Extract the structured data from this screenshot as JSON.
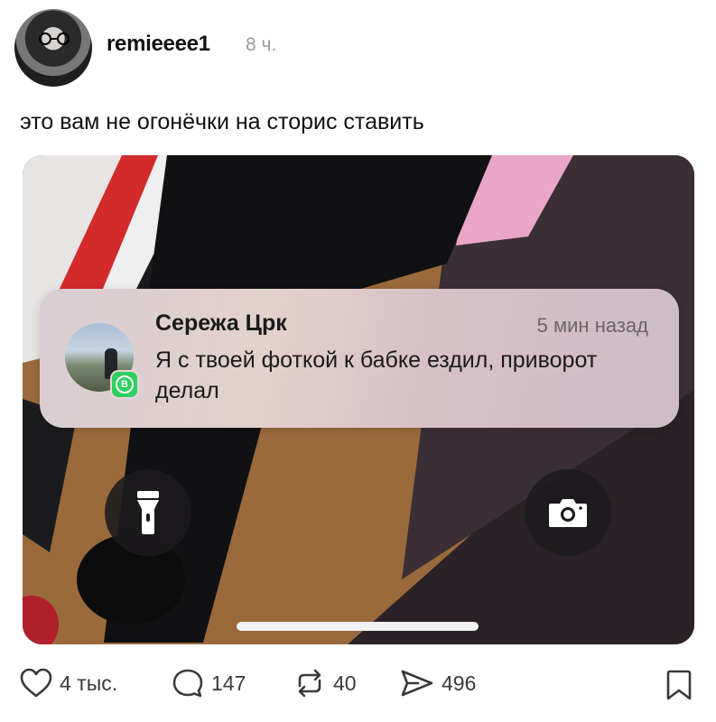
{
  "post": {
    "username": "remieeee1",
    "time": "8 ч.",
    "text": "это вам не огонёчки на сторис ставить"
  },
  "notification": {
    "sender": "Сережа Црк",
    "time": "5 мин назад",
    "message": "Я с твоей фоткой к бабке ездил, приворот делал",
    "app_icon": "whatsapp-icon",
    "badge_letter": "B"
  },
  "lockscreen": {
    "left_icon": "flashlight-icon",
    "right_icon": "camera-icon"
  },
  "actions": {
    "likes": "4 тыс.",
    "comments": "147",
    "reposts": "40",
    "shares": "496"
  },
  "colors": {
    "whatsapp_green": "#2fd05f",
    "notification_bg": "#dccfd0",
    "lock_button_bg": "#1c1a1e"
  }
}
